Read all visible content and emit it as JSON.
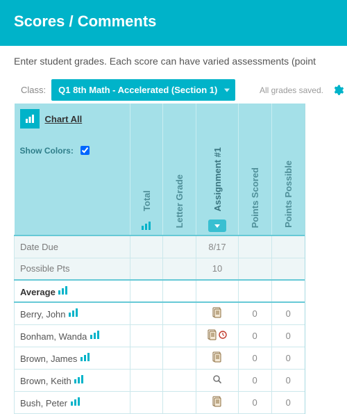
{
  "header": {
    "title": "Scores / Comments"
  },
  "intro": "Enter student grades. Each score can have varied assessments (point",
  "toolbar": {
    "class_label": "Class:",
    "class_selected": "Q1 8th Math - Accelerated (Section 1)",
    "saved_text": "All grades saved."
  },
  "grid_header": {
    "chart_all": "Chart All",
    "show_colors_label": "Show Colors:",
    "show_colors_checked": true,
    "columns": {
      "total": "Total",
      "letter": "Letter Grade",
      "assignment": "Assignment #1",
      "pts_scored": "Points Scored",
      "pts_possible": "Points Possible"
    }
  },
  "meta_rows": {
    "date_due": {
      "label": "Date Due",
      "assignment": "8/17"
    },
    "possible_pts": {
      "label": "Possible Pts",
      "assignment": "10"
    },
    "average": {
      "label": "Average"
    }
  },
  "students": [
    {
      "name": "Berry, John",
      "assign_icon": "doc",
      "pts_scored": "0",
      "pts_possible": "0"
    },
    {
      "name": "Bonham, Wanda",
      "assign_icon": "doc-clock",
      "pts_scored": "0",
      "pts_possible": "0"
    },
    {
      "name": "Brown, James",
      "assign_icon": "doc",
      "pts_scored": "0",
      "pts_possible": "0"
    },
    {
      "name": "Brown, Keith",
      "assign_icon": "search",
      "pts_scored": "0",
      "pts_possible": "0"
    },
    {
      "name": "Bush, Peter",
      "assign_icon": "doc",
      "pts_scored": "0",
      "pts_possible": "0"
    }
  ]
}
